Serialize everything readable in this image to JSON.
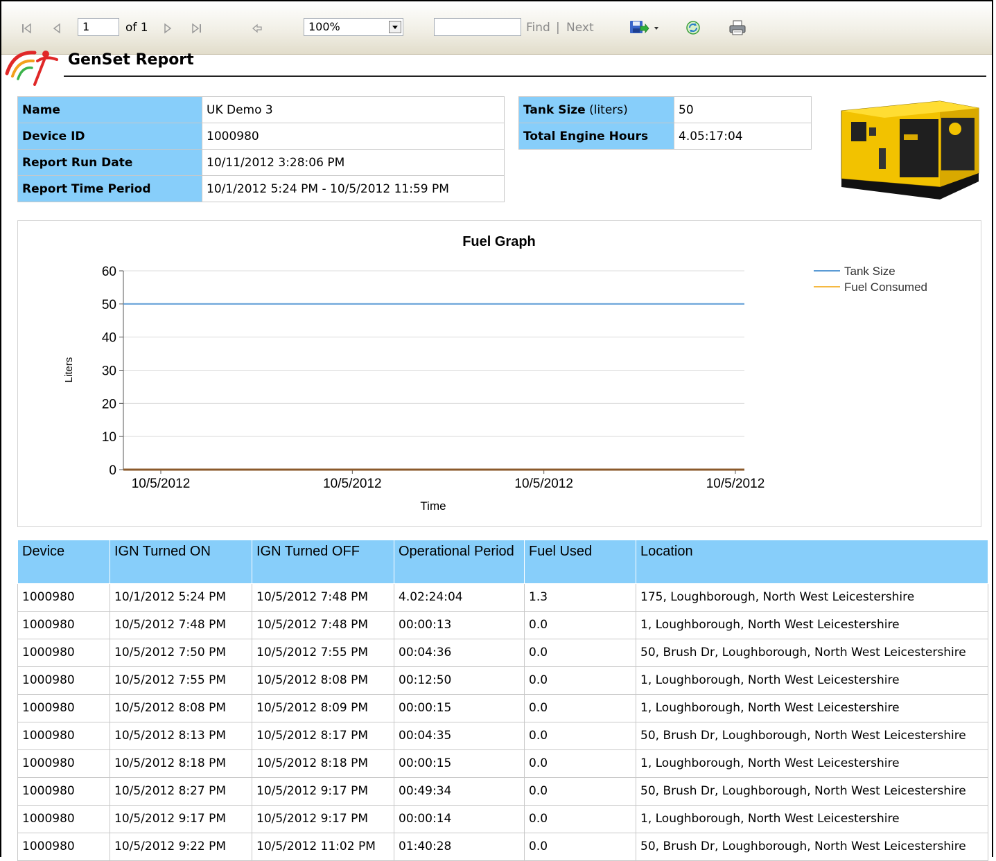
{
  "toolbar": {
    "page_value": "1",
    "page_of": "of 1",
    "zoom_value": "100%",
    "search_value": "",
    "find_label": "Find",
    "separator": "|",
    "next_label": "Next"
  },
  "report": {
    "title": "GenSet Report"
  },
  "info_left": [
    {
      "label": "Name",
      "value": "UK Demo 3"
    },
    {
      "label": "Device ID",
      "value": "1000980"
    },
    {
      "label": "Report Run Date",
      "value": "10/11/2012 3:28:06 PM"
    },
    {
      "label": "Report Time Period",
      "value": "10/1/2012 5:24 PM - 10/5/2012 11:59 PM"
    }
  ],
  "info_right": {
    "tank_label": "Tank Size",
    "tank_unit": " (liters)",
    "tank_value": "50",
    "hours_label": "Total Engine Hours",
    "hours_value": "4.05:17:04"
  },
  "chart_data": {
    "type": "line",
    "title": "Fuel Graph",
    "xlabel": "Time",
    "ylabel": "Liters",
    "ylim": [
      0,
      60
    ],
    "yticks": [
      0,
      10,
      20,
      30,
      40,
      50,
      60
    ],
    "x_tick_labels": [
      "10/5/2012",
      "10/5/2012",
      "10/5/2012",
      "10/5/2012"
    ],
    "grid": true,
    "legend_position": "top-right",
    "series": [
      {
        "name": "Tank Size",
        "color": "#5b9bd5",
        "values": [
          50,
          50,
          50,
          50
        ]
      },
      {
        "name": "Fuel Consumed",
        "color": "#f5b942",
        "values": [
          0,
          0,
          0,
          0
        ]
      }
    ]
  },
  "table": {
    "headers": [
      "Device",
      "IGN Turned ON",
      "IGN Turned OFF",
      "Operational Period",
      "Fuel Used",
      "Location"
    ],
    "rows": [
      [
        "1000980",
        "10/1/2012 5:24 PM",
        "10/5/2012 7:48 PM",
        "4.02:24:04",
        "1.3",
        "175, Loughborough, North West Leicestershire"
      ],
      [
        "1000980",
        "10/5/2012 7:48 PM",
        "10/5/2012 7:48 PM",
        "00:00:13",
        "0.0",
        "1, Loughborough, North West Leicestershire"
      ],
      [
        "1000980",
        "10/5/2012 7:50 PM",
        "10/5/2012 7:55 PM",
        "00:04:36",
        "0.0",
        "50, Brush Dr, Loughborough, North West Leicestershire"
      ],
      [
        "1000980",
        "10/5/2012 7:55 PM",
        "10/5/2012 8:08 PM",
        "00:12:50",
        "0.0",
        "1, Loughborough, North West Leicestershire"
      ],
      [
        "1000980",
        "10/5/2012 8:08 PM",
        "10/5/2012 8:09 PM",
        "00:00:15",
        "0.0",
        "1, Loughborough, North West Leicestershire"
      ],
      [
        "1000980",
        "10/5/2012 8:13 PM",
        "10/5/2012 8:17 PM",
        "00:04:35",
        "0.0",
        "50, Brush Dr, Loughborough, North West Leicestershire"
      ],
      [
        "1000980",
        "10/5/2012 8:18 PM",
        "10/5/2012 8:18 PM",
        "00:00:15",
        "0.0",
        "1, Loughborough, North West Leicestershire"
      ],
      [
        "1000980",
        "10/5/2012 8:27 PM",
        "10/5/2012 9:17 PM",
        "00:49:34",
        "0.0",
        "50, Brush Dr, Loughborough, North West Leicestershire"
      ],
      [
        "1000980",
        "10/5/2012 9:17 PM",
        "10/5/2012 9:17 PM",
        "00:00:14",
        "0.0",
        "1, Loughborough, North West Leicestershire"
      ],
      [
        "1000980",
        "10/5/2012 9:22 PM",
        "10/5/2012 11:02 PM",
        "01:40:28",
        "0.0",
        "50, Brush Dr, Loughborough, North West Leicestershire"
      ]
    ]
  },
  "icons": {
    "first_page": "first-page-icon",
    "prev_page": "previous-page-icon",
    "next_page": "next-page-icon",
    "last_page": "last-page-icon",
    "back": "back-to-parent-icon",
    "export": "export-save-icon",
    "refresh": "refresh-icon",
    "print": "print-icon",
    "logo": "company-logo",
    "generator": "generator-image"
  },
  "colors": {
    "header_blue": "#87cefa",
    "tank_line": "#5b9bd5",
    "fuel_line": "#f5b942",
    "axis_line": "#8b5a2b"
  }
}
